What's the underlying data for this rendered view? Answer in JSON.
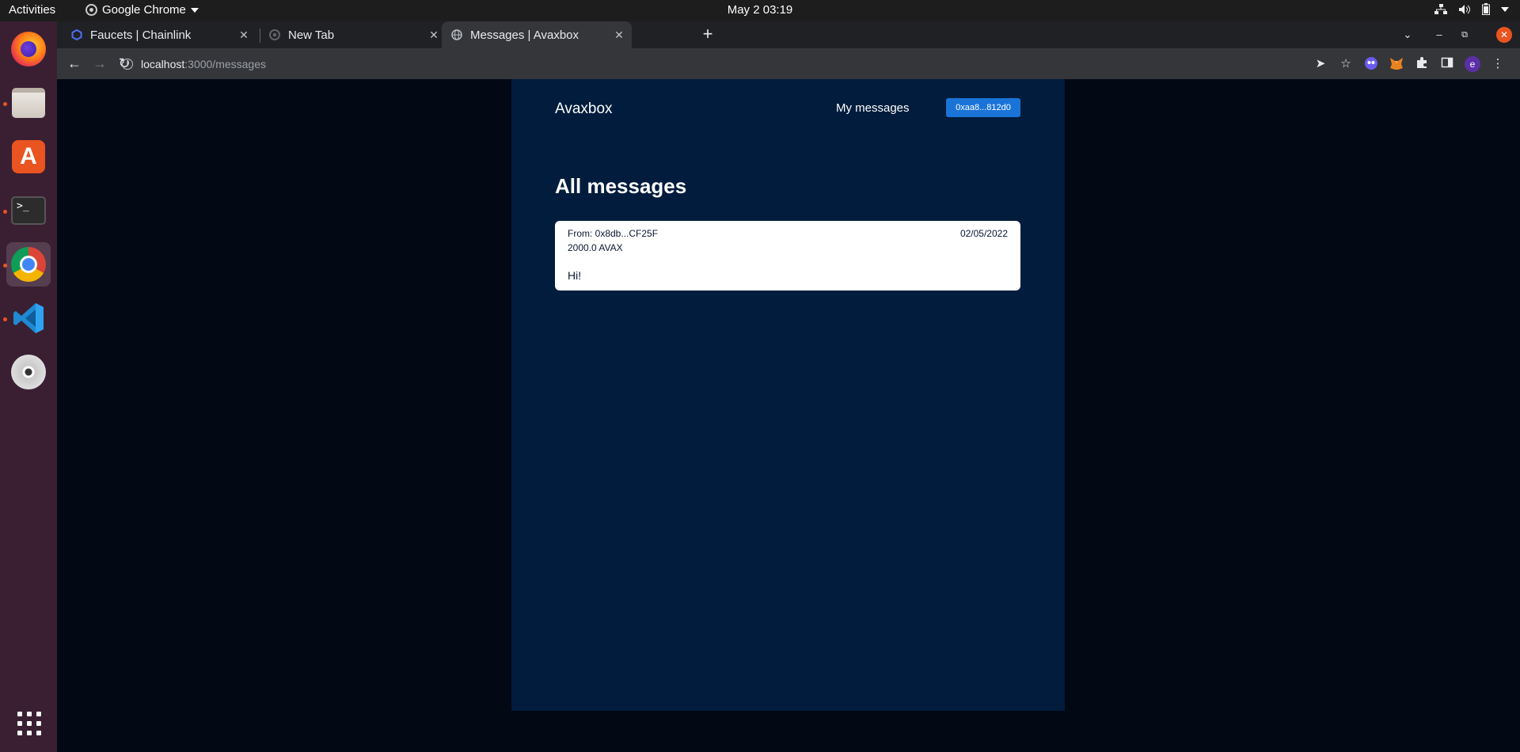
{
  "topbar": {
    "activities": "Activities",
    "app_name": "Google Chrome",
    "clock": "May 2  03:19",
    "tray_icons": [
      "network-icon",
      "volume-icon",
      "battery-icon",
      "system-menu-caret"
    ]
  },
  "dock": {
    "items": [
      "firefox-icon",
      "files-icon",
      "app-store-icon",
      "terminal-icon",
      "chrome-icon",
      "vscode-icon",
      "dvd-icon",
      "show-apps-icon"
    ],
    "accent": "#e95420"
  },
  "browser": {
    "tabs": [
      {
        "label": "Faucets | Chainlink",
        "icon": "chainlink-favicon"
      },
      {
        "label": "New Tab",
        "icon": "chrome-favicon"
      },
      {
        "label": "Messages | Avaxbox",
        "icon": "globe-favicon",
        "active": true
      }
    ],
    "url_host": "localhost",
    "url_path": ":3000/messages",
    "profile_initial": "e"
  },
  "app": {
    "brand": "Avaxbox",
    "nav_link": "My messages",
    "wallet": "0xaa8...812d0",
    "page_title": "All messages",
    "messages": [
      {
        "from": "From: 0x8db...CF25F",
        "date": "02/05/2022",
        "amount": "2000.0 AVAX",
        "body": "Hi!"
      }
    ],
    "colors": {
      "page_bg": "#020914",
      "panel_bg": "#011c3c",
      "button": "#1a74d8"
    }
  }
}
